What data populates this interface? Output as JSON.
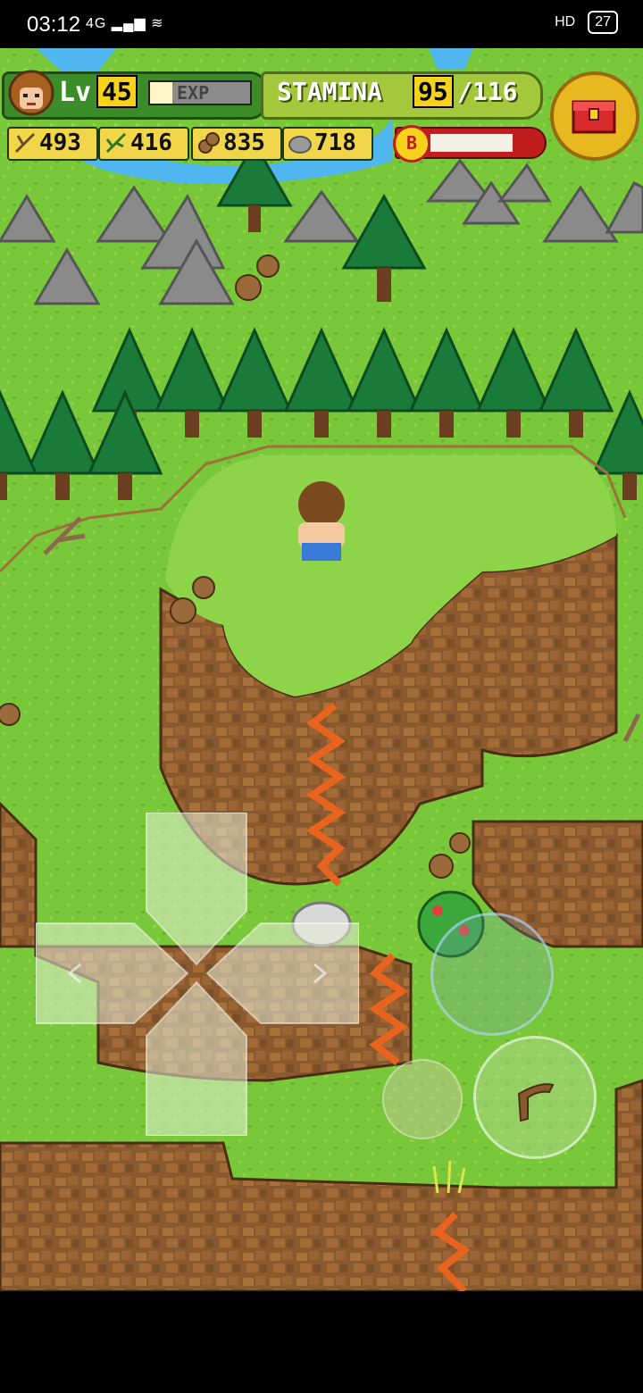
{
  "status_bar": {
    "time": "03:12",
    "network": "4G",
    "hd": "HD",
    "battery": "27"
  },
  "hud": {
    "level_label": "Lv",
    "level": "45",
    "exp_label": "EXP",
    "exp_fraction": 0.22,
    "stamina_label": "STAMINA",
    "stamina_current": "95",
    "stamina_max": "/116",
    "boost_label": "B",
    "boost_fraction": 0.78,
    "resources": [
      {
        "icon": "branch-icon",
        "value": "493"
      },
      {
        "icon": "herb-icon",
        "value": "416"
      },
      {
        "icon": "nut-icon",
        "value": "835"
      },
      {
        "icon": "stone-icon",
        "value": "718"
      }
    ]
  },
  "colors": {
    "grass": "#78c83a",
    "cliff": "#8a5a2e",
    "hud_yellow": "#f6d21b",
    "boost_red": "#c01e1e"
  },
  "controls": {
    "dpad": "dpad-icon",
    "action_buttons": [
      "tool-button",
      "item-button",
      "boomerang-button"
    ]
  }
}
